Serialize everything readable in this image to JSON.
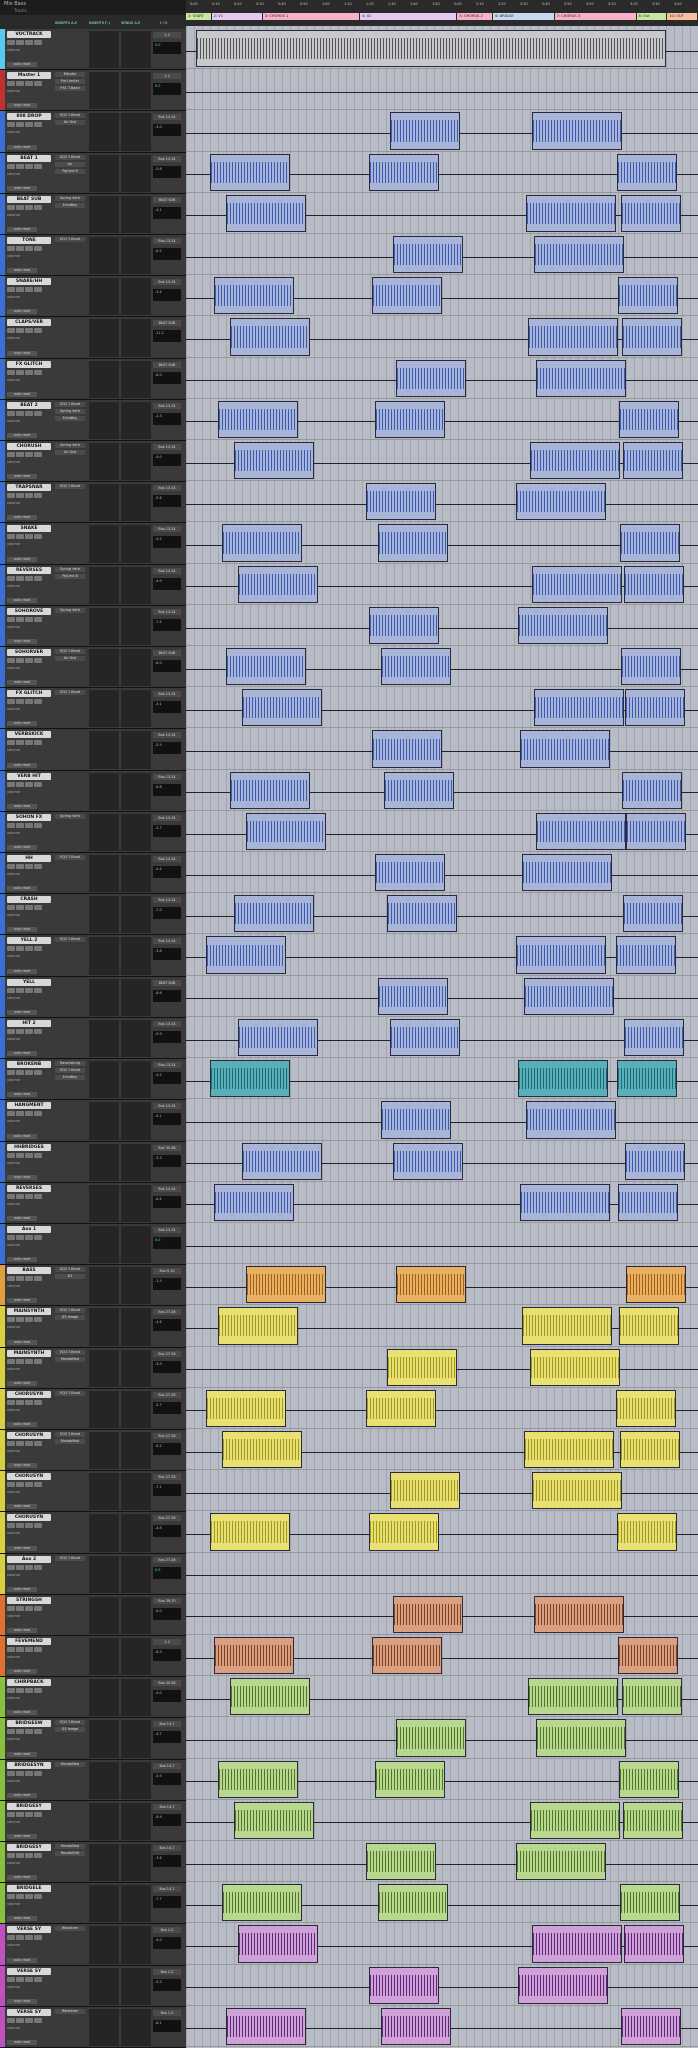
{
  "window": {
    "title": "Mix Bass",
    "subtitle": "Tracks"
  },
  "columns": [
    "INSERTS A-E",
    "INSERTS F-J",
    "SENDS A-E",
    "I / O"
  ],
  "ruler_labels": [
    "0:00",
    "0:10",
    "0:20",
    "0:30",
    "0:40",
    "0:50",
    "1:00",
    "1:10",
    "1:20",
    "1:30",
    "1:40",
    "1:50",
    "2:00",
    "2:10",
    "2:20",
    "2:30",
    "2:40",
    "2:50",
    "3:00",
    "3:10",
    "3:20",
    "3:30",
    "3:40"
  ],
  "markers": [
    {
      "label": "1: START",
      "color": "#c8e6a0",
      "span": [
        0,
        0.05
      ]
    },
    {
      "label": "2: V1",
      "color": "#e6c8f0",
      "span": [
        0.05,
        0.15
      ]
    },
    {
      "label": "3: CHORUS 1",
      "color": "#f7b0c9",
      "span": [
        0.15,
        0.34
      ]
    },
    {
      "label": "4: V2",
      "color": "#e6c8f0",
      "span": [
        0.34,
        0.53
      ]
    },
    {
      "label": "5: CHORUS 2",
      "color": "#f7b0c9",
      "span": [
        0.53,
        0.6
      ]
    },
    {
      "label": "6: BRIDGE",
      "color": "#c8d8f0",
      "span": [
        0.6,
        0.72
      ]
    },
    {
      "label": "7: CHORUS 3",
      "color": "#f7b0c9",
      "span": [
        0.72,
        0.88
      ]
    },
    {
      "label": "8: Out",
      "color": "#c8e6a0",
      "span": [
        0.88,
        0.94
      ]
    },
    {
      "label": "10: OUT",
      "color": "#f7c0a0",
      "span": [
        0.94,
        1.0
      ]
    }
  ],
  "tracks": [
    {
      "name": "VOCTRACK",
      "color": "#5bc8f0",
      "inserts": [],
      "out": "1-2",
      "vol": "0.0",
      "clips": "wave"
    },
    {
      "name": "Master 1",
      "color": "#c03030",
      "inserts": [
        "MAudio",
        "Pro Limiter",
        "PX1 T-Band"
      ],
      "out": "1-2",
      "vol": "0.0",
      "clips": "none"
    },
    {
      "name": "808 DROP",
      "color": "#3b6fd8",
      "inserts": [
        "EQ3 7-Band",
        "Air Dist"
      ],
      "out": "Bus 13-14",
      "vol": "-3.0",
      "clips": "blue"
    },
    {
      "name": "BEAT 1",
      "color": "#3b6fd8",
      "inserts": [
        "EQ3 7-Band",
        "Air",
        "PgCmd 8"
      ],
      "out": "Bus 13-14",
      "vol": "-0.8",
      "clips": "blue"
    },
    {
      "name": "BEAT SUB",
      "color": "#3b6fd8",
      "inserts": [
        "Spring Verb",
        "EchoBoy"
      ],
      "out": "BEAT SUB",
      "vol": "-4.1",
      "clips": "blue"
    },
    {
      "name": "TONE",
      "color": "#3b6fd8",
      "inserts": [
        "EQ3 7-Band"
      ],
      "out": "Bus 13-14",
      "vol": "-6.2",
      "clips": "blue"
    },
    {
      "name": "SNARE/HH",
      "color": "#3b6fd8",
      "inserts": [],
      "out": "Bus 13-14",
      "vol": "-3.4",
      "clips": "blue"
    },
    {
      "name": "CLAPS/VER",
      "color": "#3b6fd8",
      "inserts": [],
      "out": "BEAT SUB",
      "vol": "-11.2",
      "clips": "blue"
    },
    {
      "name": "FX GLITCH",
      "color": "#3b6fd8",
      "inserts": [],
      "out": "BEAT SUB",
      "vol": "-8.0",
      "clips": "blue"
    },
    {
      "name": "BEAT 2",
      "color": "#3b6fd8",
      "inserts": [
        "EQ3 7-Band",
        "Spring Verb",
        "EchoBoy"
      ],
      "out": "Bus 13-14",
      "vol": "-2.3",
      "clips": "blue"
    },
    {
      "name": "CHORUSH",
      "color": "#3b6fd8",
      "inserts": [
        "Spring Verb",
        "Air Dist"
      ],
      "out": "Bus 13-14",
      "vol": "-4.0",
      "clips": "blue"
    },
    {
      "name": "TRAPSNAR",
      "color": "#3b6fd8",
      "inserts": [
        "EQ3 7-Band"
      ],
      "out": "Bus 13-14",
      "vol": "-5.6",
      "clips": "blue"
    },
    {
      "name": "SNAKE",
      "color": "#3b6fd8",
      "inserts": [],
      "out": "Bus 13-14",
      "vol": "-9.2",
      "clips": "blue"
    },
    {
      "name": "REVERSES",
      "color": "#3b6fd8",
      "inserts": [
        "Spring Verb",
        "PgCmd 8"
      ],
      "out": "Bus 13-14",
      "vol": "-4.9",
      "clips": "blue"
    },
    {
      "name": "SOHOROVE",
      "color": "#3b6fd8",
      "inserts": [
        "Spring Verb"
      ],
      "out": "Bus 13-14",
      "vol": "-7.4",
      "clips": "blue"
    },
    {
      "name": "SOHORVER",
      "color": "#3b6fd8",
      "inserts": [
        "EQ3 7-Band",
        "Air Dist"
      ],
      "out": "BEAT SUB",
      "vol": "-6.0",
      "clips": "blue"
    },
    {
      "name": "FX GLITCH",
      "color": "#3b6fd8",
      "inserts": [
        "EQ3 7-Band"
      ],
      "out": "Bus 13-14",
      "vol": "-3.1",
      "clips": "blue"
    },
    {
      "name": "VERBSKICK",
      "color": "#3b6fd8",
      "inserts": [],
      "out": "Bus 13-14",
      "vol": "-5.5",
      "clips": "blue"
    },
    {
      "name": "VERB HIT",
      "color": "#3b6fd8",
      "inserts": [],
      "out": "Bus 13-14",
      "vol": "-8.8",
      "clips": "blue"
    },
    {
      "name": "SOHON FX",
      "color": "#3b6fd8",
      "inserts": [
        "Spring Verb"
      ],
      "out": "Bus 13-14",
      "vol": "-2.7",
      "clips": "blue"
    },
    {
      "name": "HH",
      "color": "#3b6fd8",
      "inserts": [
        "EQ3 7-Band"
      ],
      "out": "Bus 13-14",
      "vol": "-4.4",
      "clips": "blue"
    },
    {
      "name": "CRASH",
      "color": "#3b6fd8",
      "inserts": [],
      "out": "Bus 13-14",
      "vol": "-7.0",
      "clips": "blue"
    },
    {
      "name": "YELL 2",
      "color": "#3b6fd8",
      "inserts": [
        "EQ3 7-Band"
      ],
      "out": "Bus 13-14",
      "vol": "-3.8",
      "clips": "blue"
    },
    {
      "name": "YELL",
      "color": "#3b6fd8",
      "inserts": [],
      "out": "BEAT SUB",
      "vol": "-6.6",
      "clips": "blue"
    },
    {
      "name": "HIT 2",
      "color": "#3b6fd8",
      "inserts": [],
      "out": "Bus 13-14",
      "vol": "-9.9",
      "clips": "blue"
    },
    {
      "name": "BROKENB",
      "color": "#3b6fd8",
      "inserts": [
        "Ravensburg",
        "EQ3 7-Band",
        "EchoBoy"
      ],
      "out": "Bus 13-14",
      "vol": "-4.2",
      "clips": "teal"
    },
    {
      "name": "HANGMENT",
      "color": "#3b6fd8",
      "inserts": [],
      "out": "Bus 13-14",
      "vol": "-5.1",
      "clips": "blue"
    },
    {
      "name": "HHBRIDGES",
      "color": "#3b6fd8",
      "inserts": [],
      "out": "Bus 35-36",
      "vol": "-3.3",
      "clips": "blue"
    },
    {
      "name": "REVERSES",
      "color": "#3b6fd8",
      "inserts": [],
      "out": "Bus 13-14",
      "vol": "-6.4",
      "clips": "blue"
    },
    {
      "name": "Aux 1",
      "color": "#3b6fd8",
      "inserts": [],
      "out": "Bus 13-14",
      "vol": "0.0",
      "clips": "none"
    },
    {
      "name": "BASS",
      "color": "#e0a040",
      "inserts": [
        "EQ3 7-Band",
        "D3"
      ],
      "out": "Bus 9-10",
      "vol": "-1.5",
      "clips": "orange"
    },
    {
      "name": "MAINSYNTH",
      "color": "#d8d040",
      "inserts": [
        "EQ3 7-Band",
        "D3 Image"
      ],
      "out": "Bus 27-28",
      "vol": "-4.6",
      "clips": "yellow"
    },
    {
      "name": "MAINSYNTH",
      "color": "#d8d040",
      "inserts": [
        "EQ3 7-Band",
        "MondoMod"
      ],
      "out": "Bus 27-28",
      "vol": "-3.9",
      "clips": "yellow"
    },
    {
      "name": "CHORUSYN",
      "color": "#d8d040",
      "inserts": [
        "EQ3 7-Band"
      ],
      "out": "Bus 27-28",
      "vol": "-5.7",
      "clips": "yellow"
    },
    {
      "name": "CHORUSYN",
      "color": "#d8d040",
      "inserts": [
        "EQ3 7-Band",
        "MondoMod"
      ],
      "out": "Bus 27-28",
      "vol": "-6.2",
      "clips": "yellow"
    },
    {
      "name": "CHORUSYN",
      "color": "#d8d040",
      "inserts": [],
      "out": "Bus 27-28",
      "vol": "-7.1",
      "clips": "yellow"
    },
    {
      "name": "CHORUSYN",
      "color": "#d8d040",
      "inserts": [],
      "out": "Bus 27-28",
      "vol": "-4.8",
      "clips": "yellow"
    },
    {
      "name": "Aux 2",
      "color": "#d8d040",
      "inserts": [
        "EQ3 7-Band"
      ],
      "out": "Bus 27-28",
      "vol": "0.0",
      "clips": "none"
    },
    {
      "name": "STRINGSH",
      "color": "#e07030",
      "inserts": [],
      "out": "Bus 39-70",
      "vol": "-6.0",
      "clips": "orange2"
    },
    {
      "name": "FEVEMEND",
      "color": "#e07030",
      "inserts": [],
      "out": "1-2",
      "vol": "-8.3",
      "clips": "orange2"
    },
    {
      "name": "CHIRPBACK",
      "color": "#88c040",
      "inserts": [],
      "out": "Bus 35-36",
      "vol": "-9.0",
      "clips": "green"
    },
    {
      "name": "BRIDGESW",
      "color": "#88c040",
      "inserts": [
        "EQ3 7-Band",
        "D3 Image"
      ],
      "out": "Bus 14-7",
      "vol": "-4.7",
      "clips": "green"
    },
    {
      "name": "BRIDGESYN",
      "color": "#88c040",
      "inserts": [
        "MondoMod"
      ],
      "out": "Bus 14-7",
      "vol": "-5.5",
      "clips": "green"
    },
    {
      "name": "BRIDGESY",
      "color": "#88c040",
      "inserts": [],
      "out": "Bus 14-7",
      "vol": "-6.9",
      "clips": "green"
    },
    {
      "name": "BRIDGESY",
      "color": "#88c040",
      "inserts": [
        "MondoMod",
        "MondoDrift"
      ],
      "out": "Bus 14-7",
      "vol": "-3.6",
      "clips": "green"
    },
    {
      "name": "BRIDGELE",
      "color": "#88c040",
      "inserts": [],
      "out": "Bus 14-7",
      "vol": "-7.7",
      "clips": "green"
    },
    {
      "name": "VERSE SY",
      "color": "#c050c0",
      "inserts": [
        "Whatever"
      ],
      "out": "Bus 1-2",
      "vol": "-4.0",
      "clips": "purple"
    },
    {
      "name": "VERSE SY",
      "color": "#c050c0",
      "inserts": [],
      "out": "Bus 1-2",
      "vol": "-5.3",
      "clips": "purple"
    },
    {
      "name": "VERSE SY",
      "color": "#c050c0",
      "inserts": [
        "Whatever"
      ],
      "out": "Bus 1-2",
      "vol": "-6.1",
      "clips": "purple"
    }
  ],
  "labels": {
    "volume": "volume",
    "mode_read": "auto read",
    "top_name": "VOCTRACK"
  }
}
